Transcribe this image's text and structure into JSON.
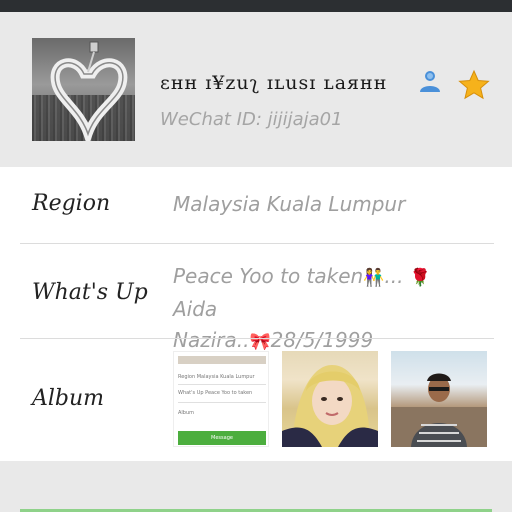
{
  "profile": {
    "display_name": "ɛнн ɪ¥zuʅ ɪʟusɪ ʟaянн",
    "wechat_id_label": "WeChat ID: jijijaja01"
  },
  "rows": {
    "region_label": "Region",
    "region_value": "Malaysia  Kuala Lumpur",
    "whatsup_label": "What's Up",
    "whatsup_text_1": "Peace Yoo to taken",
    "whatsup_emoji_couple": "👫",
    "whatsup_text_2": "...",
    "whatsup_emoji_rose": "🌹",
    "whatsup_text_3": " Aida",
    "whatsup_text_4": "Nazira..",
    "whatsup_emoji_bow": "🎀",
    "whatsup_text_5": "28/5/1999",
    "album_label": "Album"
  },
  "album_thumb_1": {
    "line1": "Region    Malaysia  Kuala Lumpur",
    "line2": "What's Up   Peace Yoo to taken",
    "line3": "Album",
    "button": "Message"
  },
  "icons": {
    "contact": "contact-person-icon",
    "star": "star-icon"
  },
  "colors": {
    "top_bar": "#2c2f32",
    "header_bg": "#e9e9e9",
    "card_bg": "#ffffff",
    "star": "#f6b21b",
    "contact_icon": "#4a90d9",
    "message_button": "#4cae3e"
  }
}
